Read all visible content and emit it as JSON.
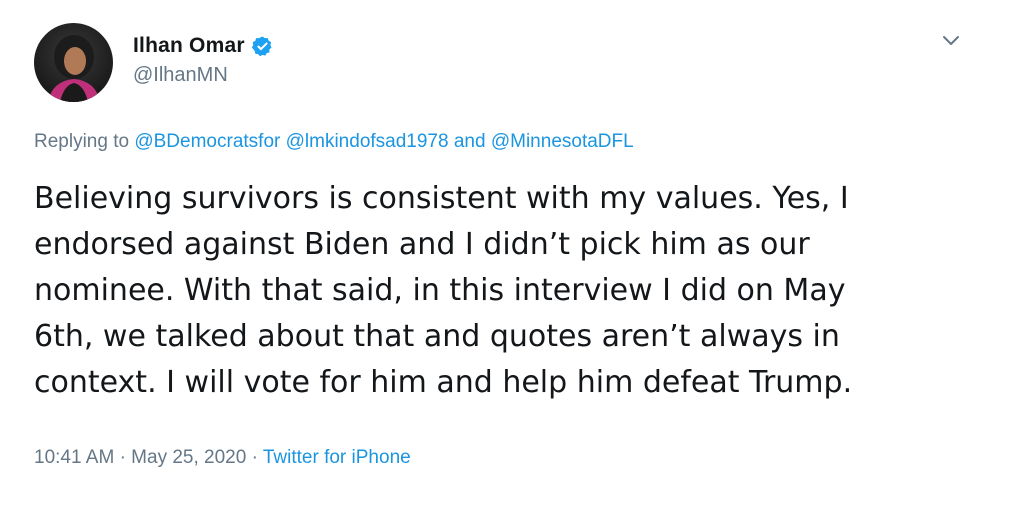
{
  "author": {
    "display_name": "Ilhan Omar",
    "handle": "@IlhanMN",
    "verified": true,
    "avatar_icon": "profile-photo"
  },
  "reply": {
    "prefix": "Replying to",
    "mentions": [
      "@BDemocratsfor",
      "@lmkindofsad1978",
      "@MinnesotaDFL"
    ],
    "joiner": "and"
  },
  "tweet": {
    "text": "Believing survivors is consistent with my values. Yes, I\nendorsed against Biden and I didn’t pick him as our\nnominee. With that said, in this interview I did on May\n6th, we talked about that and quotes aren’t always in\ncontext. I will vote for him and help him defeat Trump."
  },
  "meta": {
    "time": "10:41 AM",
    "separator": "·",
    "date": "May 25, 2020",
    "source": "Twitter for iPhone"
  },
  "icons": {
    "menu": "chevron-down-icon",
    "verified": "verified-badge-icon"
  },
  "colors": {
    "text": "#14171a",
    "secondary": "#657786",
    "link": "#1b95e0",
    "verified": "#1da1f2"
  }
}
